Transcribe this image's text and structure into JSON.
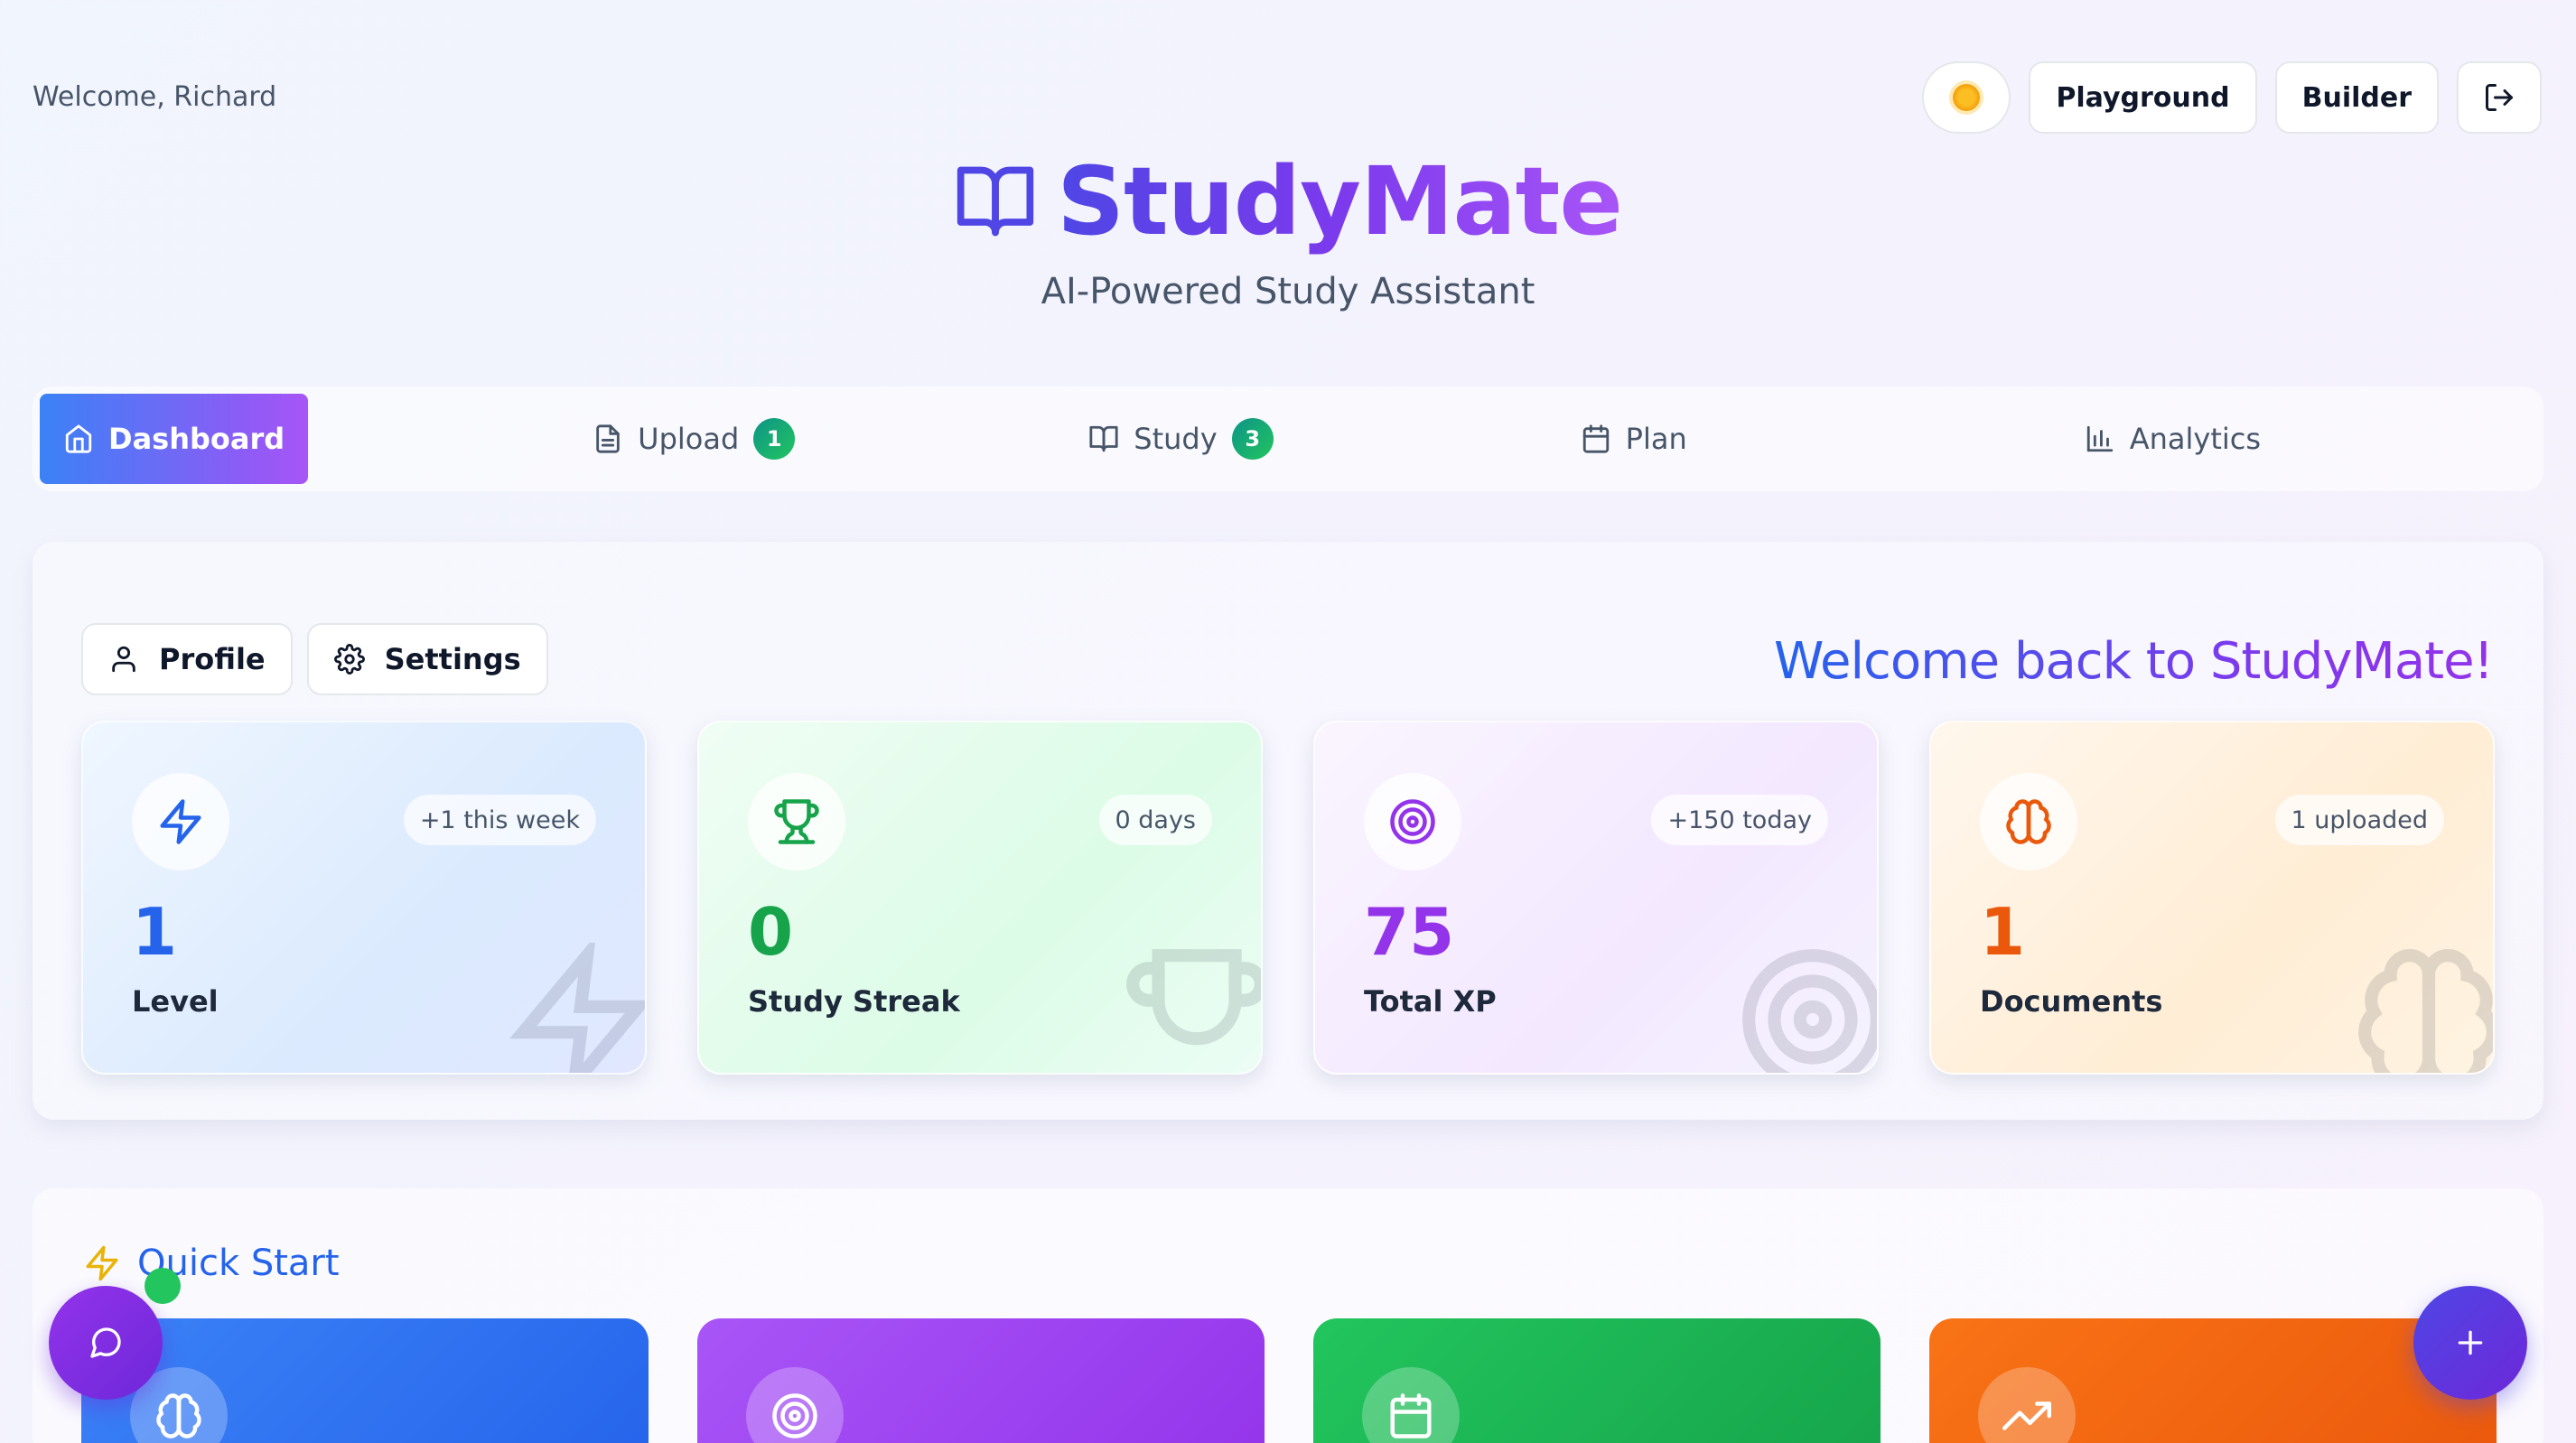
{
  "header": {
    "welcome": "Welcome, Richard",
    "theme_icon": "sun-icon",
    "playground_label": "Playground",
    "builder_label": "Builder",
    "logout_icon": "logout-icon"
  },
  "brand": {
    "title": "StudyMate",
    "subtitle": "AI-Powered Study Assistant",
    "logo_icon": "open-book-icon"
  },
  "tabs": [
    {
      "label": "Dashboard",
      "icon": "home-icon",
      "active": true
    },
    {
      "label": "Upload",
      "icon": "file-icon",
      "badge": "1"
    },
    {
      "label": "Study",
      "icon": "book-icon",
      "badge": "3"
    },
    {
      "label": "Plan",
      "icon": "calendar-icon"
    },
    {
      "label": "Analytics",
      "icon": "bar-chart-icon"
    }
  ],
  "dashboard": {
    "profile_label": "Profile",
    "settings_label": "Settings",
    "welcome_back": "Welcome back to StudyMate!",
    "stats": [
      {
        "value": "1",
        "label": "Level",
        "pill": "+1 this week",
        "icon": "lightning-icon",
        "color": "#2563eb"
      },
      {
        "value": "0",
        "label": "Study Streak",
        "pill": "0 days",
        "icon": "trophy-icon",
        "color": "#16a34a"
      },
      {
        "value": "75",
        "label": "Total XP",
        "pill": "+150 today",
        "icon": "target-icon",
        "color": "#9333ea"
      },
      {
        "value": "1",
        "label": "Documents",
        "pill": "1 uploaded",
        "icon": "brain-icon",
        "color": "#ea580c"
      }
    ]
  },
  "quick_start": {
    "title": "Quick Start",
    "cards": [
      {
        "icon": "brain-icon",
        "color": "#3b82f6"
      },
      {
        "icon": "target-icon",
        "color": "#a855f7"
      },
      {
        "icon": "calendar-icon",
        "color": "#22c55e"
      },
      {
        "icon": "trending-up-icon",
        "color": "#f97316"
      }
    ]
  },
  "fabs": {
    "chat_icon": "chat-icon",
    "add_icon": "plus-icon"
  }
}
